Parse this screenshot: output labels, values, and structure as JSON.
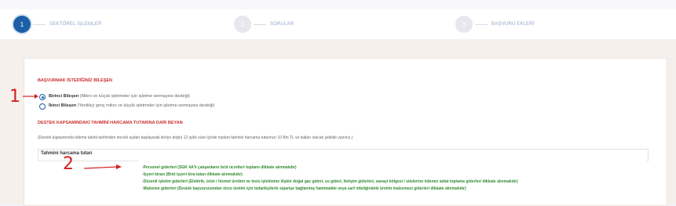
{
  "stepper": {
    "steps": [
      {
        "number": "1",
        "label": "SEKTÖREL İŞLEMLER"
      },
      {
        "number": "2",
        "label": "SORULAR"
      },
      {
        "number": "3",
        "label": "BAŞVURU EKLERİ"
      }
    ]
  },
  "section1": {
    "title": "BAŞVURMAK İSTEDİĞİNİZ BİLEŞEN",
    "options": [
      {
        "name": "Birinci Bileşen",
        "desc": " (Mikro ve küçük işletmeler için işletme sermayesi desteği)",
        "checked": true
      },
      {
        "name": "İkinci Bileşen",
        "desc": " (Yenilikçi genç mikro ve küçük işletmeler için işletme sermayesi desteği)",
        "checked": false
      }
    ]
  },
  "section2": {
    "title": "DESTEK KAPSAMINDAKİ TAHMİNİ HARCAMA TUTARINA DAİR BEYAN",
    "info": "(Destek kapsamında ödeme talebi tarihinden önceki aydan başlayarak ileriye doğru 12 aylık süre içinde toplam tahmini harcama tutarınızı 10 Bin TL ve katları olacak şekilde yazınız.)"
  },
  "amount": {
    "label": "Tahmini harcama tutarı"
  },
  "notes": [
    "-Personel giderleri (SGK 4A'lı çalışanların brüt ücretleri toplamı dikkate alınmalıdır)",
    "-İşyeri kirası (Brüt işyeri kira tutarı dikkate alınmalıdır)",
    "-Düzenli işletim giderleri (Elektrik, ürün / hizmet üretimi ve tesis işletimine ilişkin doğal gaz gideri, su gideri, iletişim giderleri, sanayi bölgesi / sitelerine ödenen aidat toplama giderleri dikkate alınmalıdır)",
    "-Malzeme giderleri (Destek başvurusundan önce üretim için tedarikçilerle siparişe bağlanmış hammadde veya sarf niteliğindeki üretim malzemesi giderleri dikkate alınmalıdır)"
  ],
  "annotations": [
    "1",
    "2"
  ],
  "colors": {
    "primary": "#1b5fa8",
    "section_title": "#c9302c",
    "notes": "#2e8b2e",
    "annotation": "#d32020"
  }
}
